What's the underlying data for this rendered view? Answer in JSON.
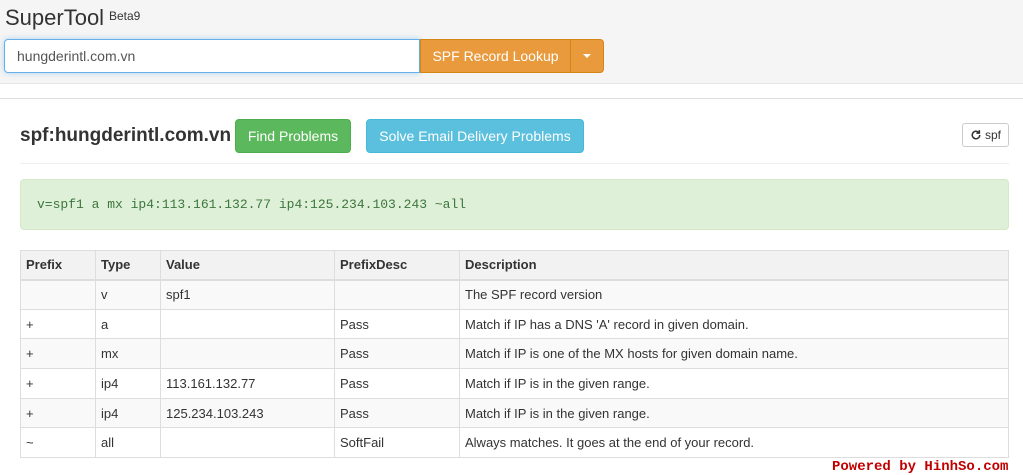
{
  "app": {
    "title": "SuperTool",
    "badge": "Beta9"
  },
  "search": {
    "value": "hungderintl.com.vn",
    "button_label": "SPF Record Lookup"
  },
  "record": {
    "title": "spf:hungderintl.com.vn",
    "find_label": "Find Problems",
    "solve_label": "Solve Email Delivery Problems",
    "refresh_label": "spf",
    "spf_text": "v=spf1 a mx ip4:113.161.132.77 ip4:125.234.103.243 ~all"
  },
  "table": {
    "headers": [
      "Prefix",
      "Type",
      "Value",
      "PrefixDesc",
      "Description"
    ],
    "rows": [
      [
        "",
        "v",
        "spf1",
        "",
        "The SPF record version"
      ],
      [
        "+",
        "a",
        "",
        "Pass",
        "Match if IP has a DNS 'A' record in given domain."
      ],
      [
        "+",
        "mx",
        "",
        "Pass",
        "Match if IP is one of the MX hosts for given domain name."
      ],
      [
        "+",
        "ip4",
        "113.161.132.77",
        "Pass",
        "Match if IP is in the given range."
      ],
      [
        "+",
        "ip4",
        "125.234.103.243",
        "Pass",
        "Match if IP is in the given range."
      ],
      [
        "~",
        "all",
        "",
        "SoftFail",
        "Always matches. It goes at the end of your record."
      ]
    ]
  },
  "watermark": "Powered by HinhSo.com",
  "colors": {
    "lookup_orange": "#e89a3c",
    "find_green": "#5cb85c",
    "solve_blue": "#5bc0de",
    "record_bg": "#dff0d8",
    "record_text": "#3c763d"
  },
  "icons": {
    "refresh": "refresh-icon",
    "dropdown": "caret-down-icon"
  }
}
